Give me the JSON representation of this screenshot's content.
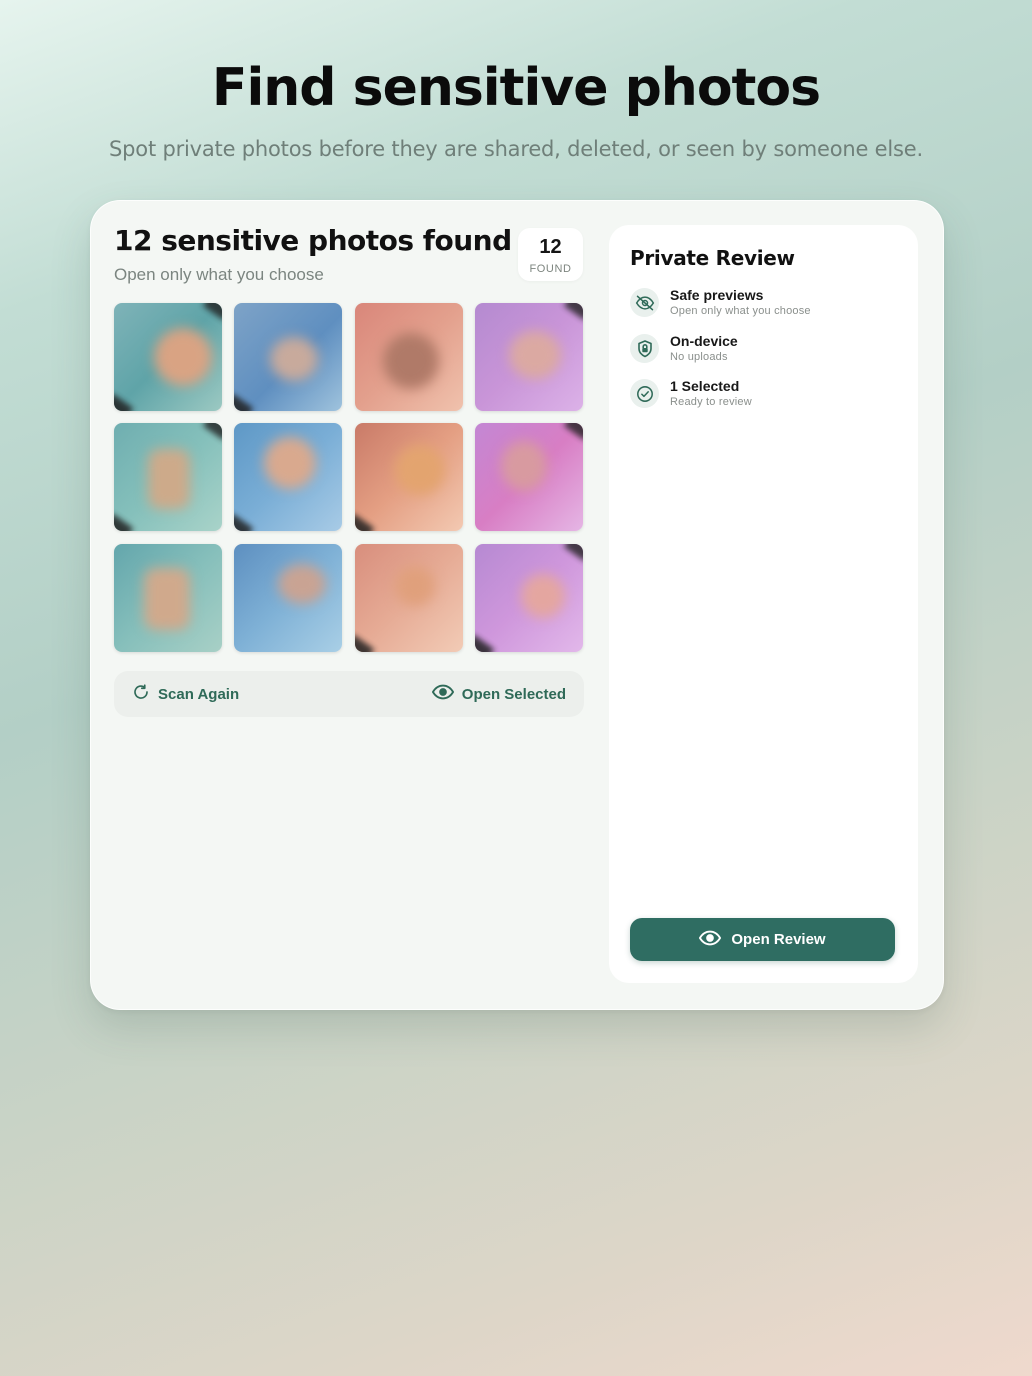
{
  "hero": {
    "title": "Find sensitive photos",
    "subtitle": "Spot private photos before they are shared, deleted, or seen by someone else."
  },
  "results": {
    "title": "12 sensitive photos found",
    "subtitle": "Open only what you choose",
    "badge_count": "12",
    "badge_label": "FOUND"
  },
  "thumbnails": [
    {
      "tone": "teal"
    },
    {
      "tone": "blue"
    },
    {
      "tone": "peach"
    },
    {
      "tone": "violet"
    },
    {
      "tone": "teal"
    },
    {
      "tone": "blue"
    },
    {
      "tone": "peach"
    },
    {
      "tone": "violet"
    },
    {
      "tone": "teal"
    },
    {
      "tone": "blue"
    },
    {
      "tone": "peach"
    },
    {
      "tone": "violet"
    }
  ],
  "actions": {
    "scan_again": "Scan Again",
    "open_selected": "Open Selected"
  },
  "review_panel": {
    "title": "Private Review",
    "features": [
      {
        "title": "Safe previews",
        "subtitle": "Open only what you choose",
        "icon": "eye-slash-icon"
      },
      {
        "title": "On-device",
        "subtitle": "No uploads",
        "icon": "lock-shield-icon"
      },
      {
        "title": "1 Selected",
        "subtitle": "Ready to review",
        "icon": "check-circle-icon"
      }
    ],
    "button": "Open Review"
  },
  "colors": {
    "accent": "#2f6d62",
    "accent_text": "#2f6a58",
    "card_bg": "#f4f7f4"
  }
}
